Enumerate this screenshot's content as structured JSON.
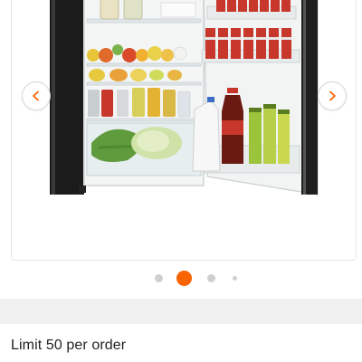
{
  "product": {
    "image_alt": "Compact refrigerator with door open, stocked with fruit, vegetables, soda cans and bottles",
    "limit_text": "Limit 50 per order"
  },
  "carousel": {
    "slide_count": 4,
    "active_index": 1,
    "prev_icon": "chevron-left-icon",
    "next_icon": "chevron-right-icon"
  },
  "colors": {
    "accent": "#f96302",
    "arrow": "#f96302",
    "dot_inactive": "#cfcfcf",
    "band": "#f0f0f0"
  }
}
